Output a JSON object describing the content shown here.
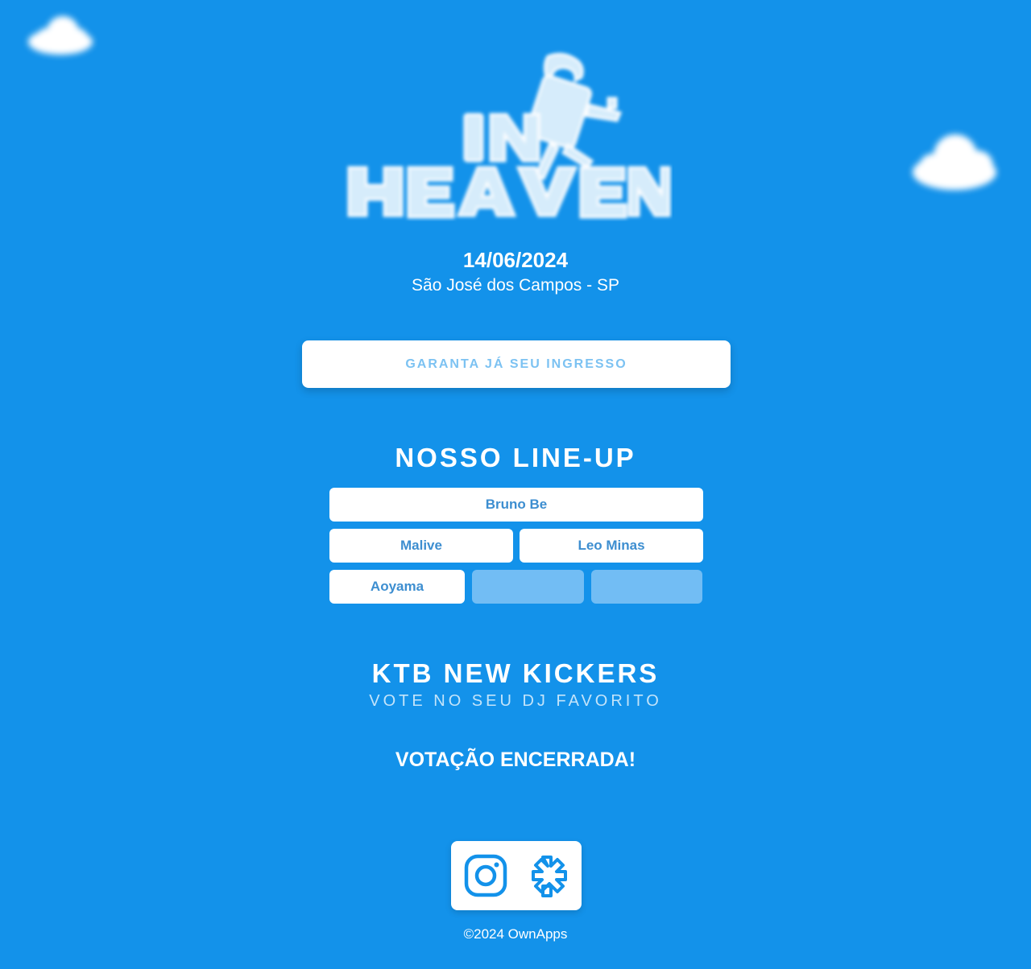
{
  "event": {
    "date": "14/06/2024",
    "location": "São José dos Campos - SP"
  },
  "ticket_button": {
    "label": "GARANTA JÁ SEU INGRESSO"
  },
  "lineup": {
    "title": "NOSSO LINE-UP",
    "artists": [
      "Bruno Be",
      "Malive",
      "Leo Minas",
      "Aoyama"
    ]
  },
  "kickers": {
    "title": "KTB NEW KICKERS",
    "subtitle": "VOTE NO SEU DJ FAVORITO",
    "status": "VOTAÇÃO ENCERRADA!"
  },
  "social": {
    "icons": [
      "instagram-icon",
      "linktree-icon"
    ]
  },
  "footer": {
    "copyright": "©2024 OwnApps"
  },
  "colors": {
    "background": "#1392ea",
    "button_text": "#7cc2f2",
    "artist_text": "#3d8ed0",
    "empty_slot": "#72bdf4"
  }
}
